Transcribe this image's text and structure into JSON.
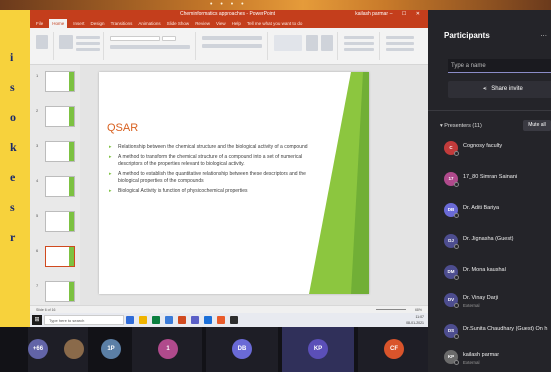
{
  "decor": {
    "dots": "• • • •"
  },
  "left_banner": {
    "letters": [
      "i",
      "s",
      "o",
      "k",
      "e",
      "s",
      "r"
    ]
  },
  "ppt": {
    "window_title": "Cheminformatics approaches - PowerPoint",
    "user": "kailash parmar",
    "window_buttons": "– ☐ ✕",
    "menu_tabs": [
      "File",
      "Home",
      "Insert",
      "Design",
      "Transitions",
      "Animations",
      "Slide Show",
      "Review",
      "View",
      "Help",
      "Tell me what you want to do"
    ],
    "thumbnail_numbers": [
      "1",
      "2",
      "3",
      "4",
      "5",
      "6",
      "7"
    ],
    "slide": {
      "title": "QSAR",
      "bullets": [
        "Relationship between the chemical structure and the biological activity of a compound",
        "A method to transform the chemical structure of a compound into a set of numerical descriptors of the properties relevant to biological activity.",
        "A method to establish the quantitative relationship between these descriptors and the biological properties of the compounds",
        "Biological Activity is function of physicochemical properties"
      ]
    },
    "status_left": "Slide 6 of 16",
    "zoom": "68%"
  },
  "taskbar": {
    "start": "⊞",
    "search_placeholder": "Type here to search",
    "time": "11:07",
    "date": "08-01-2021",
    "app_colors": [
      "#2f6bd8",
      "#f0b400",
      "#0a7f3f",
      "#3b7bd8",
      "#d04a1f",
      "#5b5fc7",
      "#1b6fd8",
      "#e95b2a",
      "#2d2d2d"
    ]
  },
  "participants": {
    "header": "Participants",
    "more": "...",
    "search_placeholder": "Type a name",
    "invite_icon": "⪪",
    "invite_label": "Share invite",
    "section": "Presenters (11)",
    "mute_all": "Mute all",
    "people": [
      {
        "name": "Cognosy faculty",
        "sub": "",
        "initials": "C",
        "color": "#c23b3b"
      },
      {
        "name": "17_80 Simran Sainani",
        "sub": "",
        "initials": "17",
        "color": "#b04a8c"
      },
      {
        "name": "Dr. Aditi Bariya",
        "sub": "",
        "initials": "DB",
        "color": "#6a6ad6"
      },
      {
        "name": "Dr. Jignasha (Guest)",
        "sub": "",
        "initials": "DJ",
        "color": "#4d4d8f"
      },
      {
        "name": "Dr. Mona kaushal",
        "sub": "",
        "initials": "DM",
        "color": "#4d4d8f"
      },
      {
        "name": "Dr. Vinay Darji",
        "sub": "External",
        "initials": "DV",
        "color": "#4d4d8f"
      },
      {
        "name": "Dr.Sunita Chaudhary (Guest) On h",
        "sub": "",
        "initials": "DS",
        "color": "#4d4d8f"
      },
      {
        "name": "kailash parmar",
        "sub": "External",
        "initials": "KP",
        "color": "#6b6b6b"
      }
    ]
  },
  "meeting": {
    "tiles": [
      {
        "label": "+66",
        "color": "#6264a7",
        "caption": ""
      },
      {
        "label": "",
        "color": "#8a6a4a",
        "caption": ""
      },
      {
        "label": "1P",
        "color": "#5b7fa6",
        "caption": ""
      },
      {
        "label": "1",
        "color": "#b04a8c",
        "caption": ""
      },
      {
        "label": "DB",
        "color": "#6a6ad6",
        "caption": ""
      },
      {
        "label": "KP",
        "color": "#5b4fb8",
        "caption": ""
      },
      {
        "label": "CF",
        "color": "#d9542b",
        "caption": ""
      }
    ]
  }
}
